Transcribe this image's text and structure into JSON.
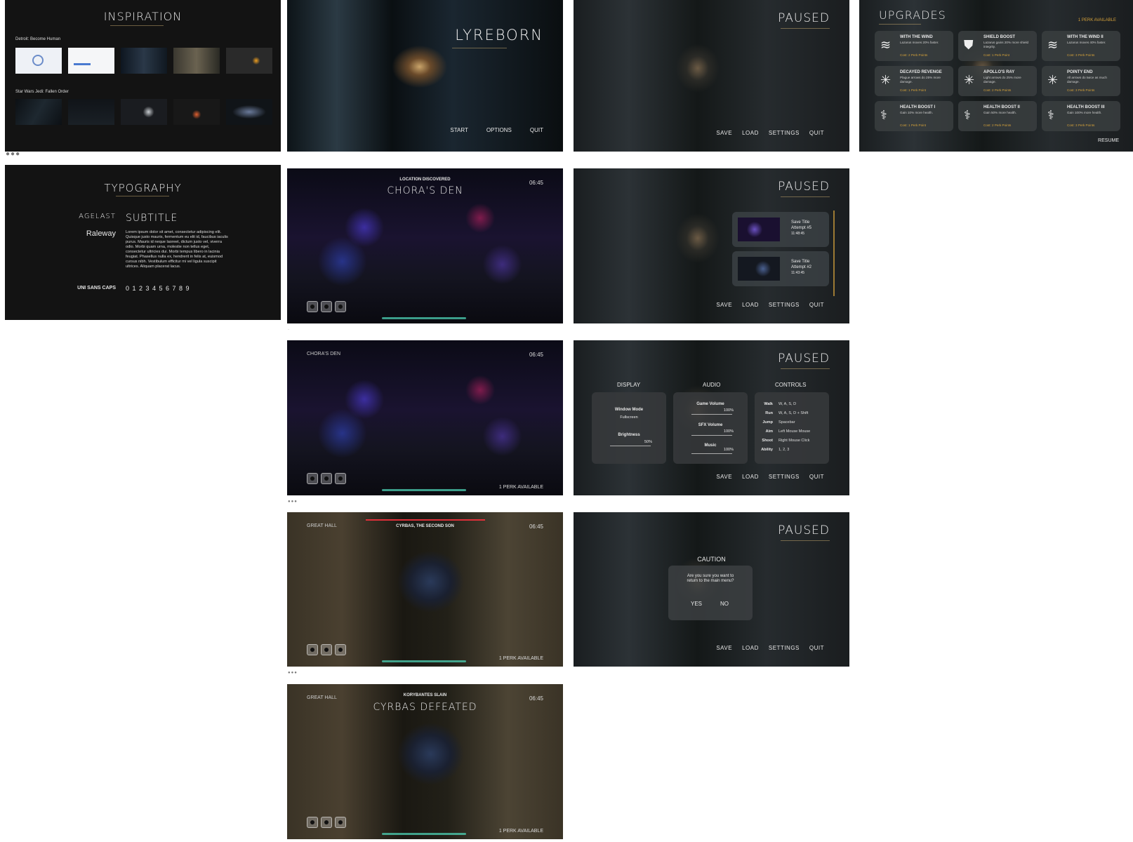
{
  "inspiration": {
    "title": "INSPIRATION",
    "group1_label": "Detroit: Become Human",
    "group2_label": "Star Wars Jedi: Fallen Order"
  },
  "title_screen": {
    "title": "LYREBORN",
    "menu": [
      "START",
      "OPTIONS",
      "QUIT"
    ]
  },
  "pause_menu": {
    "title": "PAUSED",
    "items": [
      "SAVE",
      "LOAD",
      "SETTINGS",
      "QUIT"
    ]
  },
  "upgrades": {
    "title": "UPGRADES",
    "perk_available": "1 PERK AVAILABLE",
    "resume": "RESUME",
    "items": [
      {
        "name": "WITH THE WIND",
        "desc": "Lazarus moves 20% faster.",
        "cost": "Cost: 2 Perk Points",
        "icon": "wind-icon"
      },
      {
        "name": "SHIELD BOOST",
        "desc": "Lazarus gains 20% more shield integrity.",
        "cost": "Cost: 1 Perk Point",
        "icon": "shield-icon"
      },
      {
        "name": "WITH THE WIND II",
        "desc": "Lazarus moves 40% faster.",
        "cost": "Cost: 3 Perk Points",
        "icon": "wind-icon"
      },
      {
        "name": "DECAYED REVENGE",
        "desc": "Plague arrows do 25% more damage.",
        "cost": "Cost: 1 Perk Point",
        "icon": "burst-icon"
      },
      {
        "name": "APOLLO'S RAY",
        "desc": "Light arrows do 25% more damage.",
        "cost": "Cost: 2 Perk Points",
        "icon": "burst-icon"
      },
      {
        "name": "POINTY END",
        "desc": "All arrows do twice as much damage.",
        "cost": "Cost: 3 Perk Points",
        "icon": "burst-icon"
      },
      {
        "name": "HEALTH BOOST I",
        "desc": "Gain 10% more health.",
        "cost": "Cost: 1 Perk Point",
        "icon": "health-icon"
      },
      {
        "name": "HEALTH BOOST II",
        "desc": "Gain 50% more health.",
        "cost": "Cost: 2 Perk Points",
        "icon": "health-icon"
      },
      {
        "name": "HEALTH BOOST III",
        "desc": "Gain 100% more health.",
        "cost": "Cost: 3 Perk Points",
        "icon": "health-icon"
      }
    ]
  },
  "typography": {
    "title": "TYPOGRAPHY",
    "font1_name": "AGELAST",
    "font1_sample": "SUBTITLE",
    "font2_name": "Raleway",
    "font2_sample": "Lorem ipsum dolor sit amet, consectetur adipiscing elit. Quisque justo mauris, fermentum eu elit id, faucibus iaculis purus. Mauris id neque laoreet, dictum justo vel, viverra odio. Morbi quam urna, molestie non tellus eget, consectetur ultricies dui. Morbi tempus libero in lacinia feugiat. Phasellus nulla ex, hendrerit in felis at, euismod cursus nibh. Vestibulum efficitur mi vel ligula suscipit ultrices. Aliquam placerat lacus.",
    "font3_name": "UNI SANS CAPS",
    "font3_sample": "0 1 2 3 4 5 6 7 8 9"
  },
  "hud": {
    "time": "06:45",
    "location_label": "LOCATION DISCOVERED",
    "location_name": "CHORA'S DEN",
    "location_small": "CHORA'S DEN",
    "great_hall": "GREAT HALL",
    "boss_name": "CYRBAS, THE SECOND SON",
    "perk_available": "1 PERK AVAILABLE",
    "defeated_label": "KORYBANTES SLAIN",
    "defeated_title": "CYRBAS DEFEATED"
  },
  "saves": [
    {
      "title": "Save Title",
      "attempt": "Attempt #5",
      "time": "11:48:45"
    },
    {
      "title": "Save Title",
      "attempt": "Attempt #2",
      "time": "11:43:45"
    }
  ],
  "settings": {
    "headers": [
      "DISPLAY",
      "AUDIO",
      "CONTROLS"
    ],
    "display": [
      {
        "label": "Window Mode",
        "value": "Fullscreen"
      },
      {
        "label": "Brightness",
        "value": "50%"
      }
    ],
    "audio": [
      {
        "label": "Game Volume",
        "value": "100%"
      },
      {
        "label": "SFX Volume",
        "value": "100%"
      },
      {
        "label": "Music",
        "value": "100%"
      }
    ],
    "controls": [
      {
        "label": "Walk",
        "value": "W, A, S, D"
      },
      {
        "label": "Run",
        "value": "W, A, S, D + Shift"
      },
      {
        "label": "Jump",
        "value": "Spacebar"
      },
      {
        "label": "Aim",
        "value": "Left Mouse Mouse"
      },
      {
        "label": "Shoot",
        "value": "Right Mouse Click"
      },
      {
        "label": "Ability",
        "value": "1, 2, 3"
      }
    ]
  },
  "caution": {
    "title": "CAUTION",
    "message": "Are you sure you want to return to the main menu?",
    "yes": "YES",
    "no": "NO"
  },
  "colors": {
    "accent_gold": "#d4a13a",
    "health_teal": "#55d6b8",
    "boss_red": "#e0303a"
  }
}
